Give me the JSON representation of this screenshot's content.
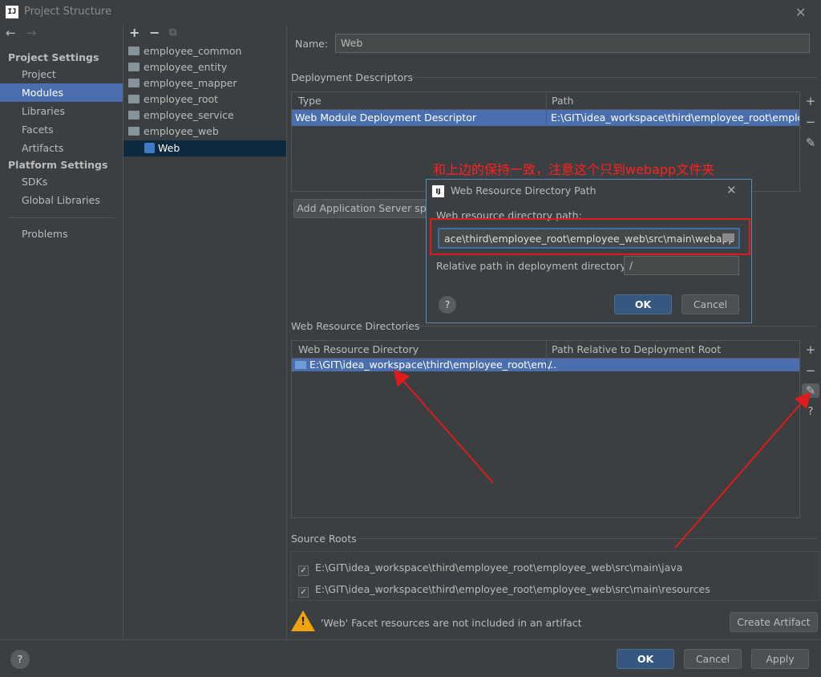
{
  "window": {
    "title": "Project Structure",
    "logo": "IJ"
  },
  "left_nav": {
    "project_settings_heading": "Project Settings",
    "project_items": [
      "Project",
      "Modules",
      "Libraries",
      "Facets",
      "Artifacts"
    ],
    "platform_settings_heading": "Platform Settings",
    "platform_items": [
      "SDKs",
      "Global Libraries"
    ],
    "problems": "Problems",
    "selected": "Modules"
  },
  "modules": {
    "items": [
      "employee_common",
      "employee_entity",
      "employee_mapper",
      "employee_root",
      "employee_service",
      "employee_web"
    ],
    "selected_child": "Web"
  },
  "main": {
    "name_label": "Name:",
    "name_value": "Web",
    "deployment_descriptors": {
      "heading": "Deployment Descriptors",
      "col_type": "Type",
      "col_path": "Path",
      "row_type": "Web Module Deployment Descriptor",
      "row_path": "E:\\GIT\\idea_workspace\\third\\employee_root\\employe"
    },
    "add_server_button": "Add Application Server sp",
    "web_resource_dirs": {
      "heading": "Web Resource Directories",
      "col_dir": "Web Resource Directory",
      "col_rel": "Path Relative to Deployment Root",
      "row_dir": "E:\\GIT\\idea_workspace\\third\\employee_root\\em...",
      "row_rel": "/"
    },
    "source_roots": {
      "heading": "Source Roots",
      "items": [
        "E:\\GIT\\idea_workspace\\third\\employee_root\\employee_web\\src\\main\\java",
        "E:\\GIT\\idea_workspace\\third\\employee_root\\employee_web\\src\\main\\resources"
      ]
    },
    "warning_text": "'Web' Facet resources are not included in an artifact",
    "create_artifact_button": "Create Artifact"
  },
  "dialog": {
    "title": "Web Resource Directory Path",
    "path_label": "Web resource directory path:",
    "path_value": "ace\\third\\employee_root\\employee_web\\src\\main\\webapp",
    "relative_label": "Relative path in deployment directory:",
    "relative_value": "/",
    "ok": "OK",
    "cancel": "Cancel",
    "help": "?"
  },
  "annotation": {
    "note": "和上边的保持一致，注意这个只到webapp文件夹"
  },
  "footer": {
    "ok": "OK",
    "cancel": "Cancel",
    "apply": "Apply",
    "help": "?"
  },
  "colors": {
    "selection": "#4b6eaf",
    "annotation_red": "#e01b1b",
    "primary_button": "#365880"
  }
}
